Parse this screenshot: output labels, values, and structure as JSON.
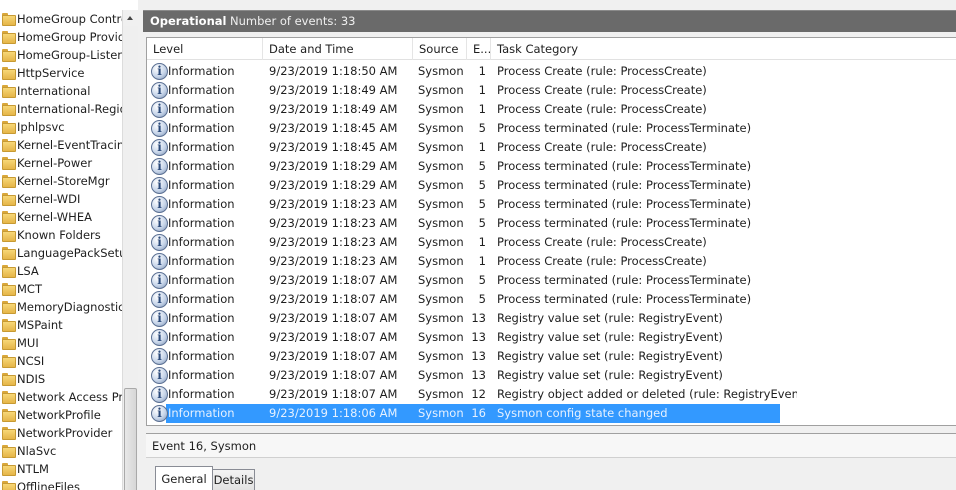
{
  "tree": {
    "items": [
      "HomeGroup Contro",
      "HomeGroup Provid",
      "HomeGroup-Listene",
      "HttpService",
      "International",
      "International-Regio",
      "Iphlpsvc",
      "Kernel-EventTracing",
      "Kernel-Power",
      "Kernel-StoreMgr",
      "Kernel-WDI",
      "Kernel-WHEA",
      "Known Folders",
      "LanguagePackSetup",
      "LSA",
      "MCT",
      "MemoryDiagnostics",
      "MSPaint",
      "MUI",
      "NCSI",
      "NDIS",
      "Network Access Pro",
      "NetworkProfile",
      "NetworkProvider",
      "NlaSvc",
      "NTLM",
      "OfflineFiles"
    ],
    "item_icon": "folder-icon"
  },
  "log": {
    "name": "Operational",
    "count_label": "Number of events: 33"
  },
  "grid": {
    "columns": [
      "Level",
      "Date and Time",
      "Source",
      "E...",
      "Task Category"
    ],
    "rows": [
      {
        "level": "Information",
        "date": "9/23/2019 1:18:50 AM",
        "source": "Sysmon",
        "eid": "1",
        "task": "Process Create (rule: ProcessCreate)"
      },
      {
        "level": "Information",
        "date": "9/23/2019 1:18:49 AM",
        "source": "Sysmon",
        "eid": "1",
        "task": "Process Create (rule: ProcessCreate)"
      },
      {
        "level": "Information",
        "date": "9/23/2019 1:18:49 AM",
        "source": "Sysmon",
        "eid": "1",
        "task": "Process Create (rule: ProcessCreate)"
      },
      {
        "level": "Information",
        "date": "9/23/2019 1:18:45 AM",
        "source": "Sysmon",
        "eid": "5",
        "task": "Process terminated (rule: ProcessTerminate)"
      },
      {
        "level": "Information",
        "date": "9/23/2019 1:18:45 AM",
        "source": "Sysmon",
        "eid": "1",
        "task": "Process Create (rule: ProcessCreate)"
      },
      {
        "level": "Information",
        "date": "9/23/2019 1:18:29 AM",
        "source": "Sysmon",
        "eid": "5",
        "task": "Process terminated (rule: ProcessTerminate)"
      },
      {
        "level": "Information",
        "date": "9/23/2019 1:18:29 AM",
        "source": "Sysmon",
        "eid": "5",
        "task": "Process terminated (rule: ProcessTerminate)"
      },
      {
        "level": "Information",
        "date": "9/23/2019 1:18:23 AM",
        "source": "Sysmon",
        "eid": "5",
        "task": "Process terminated (rule: ProcessTerminate)"
      },
      {
        "level": "Information",
        "date": "9/23/2019 1:18:23 AM",
        "source": "Sysmon",
        "eid": "5",
        "task": "Process terminated (rule: ProcessTerminate)"
      },
      {
        "level": "Information",
        "date": "9/23/2019 1:18:23 AM",
        "source": "Sysmon",
        "eid": "1",
        "task": "Process Create (rule: ProcessCreate)"
      },
      {
        "level": "Information",
        "date": "9/23/2019 1:18:23 AM",
        "source": "Sysmon",
        "eid": "1",
        "task": "Process Create (rule: ProcessCreate)"
      },
      {
        "level": "Information",
        "date": "9/23/2019 1:18:07 AM",
        "source": "Sysmon",
        "eid": "5",
        "task": "Process terminated (rule: ProcessTerminate)"
      },
      {
        "level": "Information",
        "date": "9/23/2019 1:18:07 AM",
        "source": "Sysmon",
        "eid": "5",
        "task": "Process terminated (rule: ProcessTerminate)"
      },
      {
        "level": "Information",
        "date": "9/23/2019 1:18:07 AM",
        "source": "Sysmon",
        "eid": "13",
        "task": "Registry value set (rule: RegistryEvent)"
      },
      {
        "level": "Information",
        "date": "9/23/2019 1:18:07 AM",
        "source": "Sysmon",
        "eid": "13",
        "task": "Registry value set (rule: RegistryEvent)"
      },
      {
        "level": "Information",
        "date": "9/23/2019 1:18:07 AM",
        "source": "Sysmon",
        "eid": "13",
        "task": "Registry value set (rule: RegistryEvent)"
      },
      {
        "level": "Information",
        "date": "9/23/2019 1:18:07 AM",
        "source": "Sysmon",
        "eid": "13",
        "task": "Registry value set (rule: RegistryEvent)"
      },
      {
        "level": "Information",
        "date": "9/23/2019 1:18:07 AM",
        "source": "Sysmon",
        "eid": "12",
        "task": "Registry object added or deleted (rule: RegistryEvent)"
      },
      {
        "level": "Information",
        "date": "9/23/2019 1:18:06 AM",
        "source": "Sysmon",
        "eid": "16",
        "task": "Sysmon config state changed"
      }
    ],
    "selected_index": 18,
    "level_icon": "info-icon"
  },
  "detail": {
    "title": "Event 16, Sysmon",
    "tabs": [
      "General",
      "Details"
    ],
    "active_tab": "General"
  },
  "colors": {
    "selection": "#3399ff",
    "titlebar": "#6a6a6a"
  }
}
